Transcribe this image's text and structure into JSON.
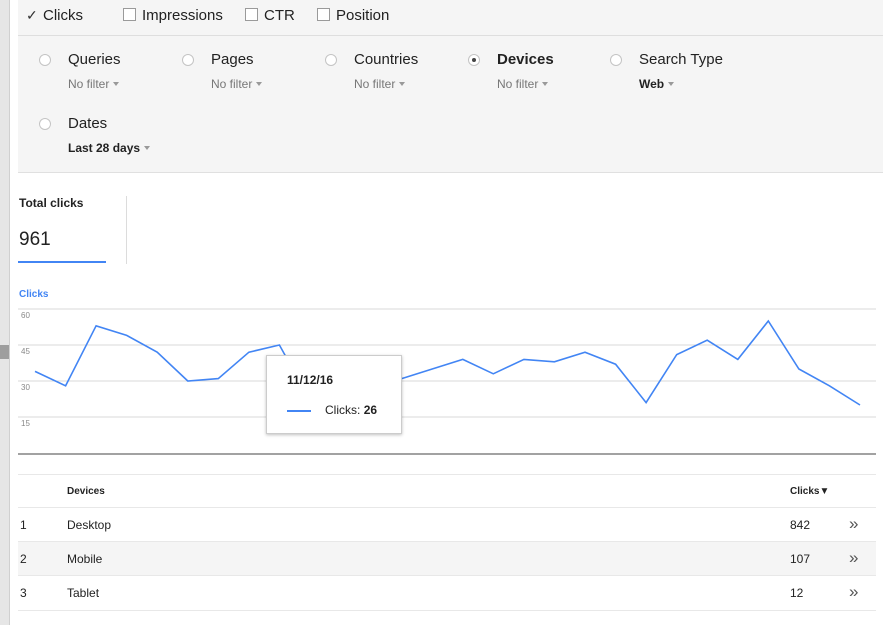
{
  "metrics": [
    {
      "label": "Clicks",
      "checked": true
    },
    {
      "label": "Impressions",
      "checked": false
    },
    {
      "label": "CTR",
      "checked": false
    },
    {
      "label": "Position",
      "checked": false
    }
  ],
  "check_glyph": "✓",
  "filters": [
    {
      "name": "Queries",
      "value": "No filter",
      "selected": false
    },
    {
      "name": "Pages",
      "value": "No filter",
      "selected": false
    },
    {
      "name": "Countries",
      "value": "No filter",
      "selected": false
    },
    {
      "name": "Devices",
      "value": "No filter",
      "selected": true
    },
    {
      "name": "Search Type",
      "value": "Web",
      "selected": false
    },
    {
      "name": "Dates",
      "value": "Last 28 days",
      "selected": false
    }
  ],
  "totals": {
    "label": "Total clicks",
    "value": "961"
  },
  "chart_data": {
    "type": "line",
    "title": "Clicks",
    "y_ticks": [
      60,
      45,
      30,
      15
    ],
    "ylim": [
      0,
      60
    ],
    "series": [
      {
        "name": "Clicks",
        "color": "#4285f4",
        "values": [
          34,
          28,
          53,
          49,
          42,
          30,
          31,
          42,
          45,
          22,
          18,
          27,
          31,
          35,
          39,
          33,
          39,
          38,
          42,
          37,
          21,
          41,
          47,
          39,
          55,
          35,
          28,
          20
        ]
      }
    ],
    "grid": true,
    "highlight_index": 11
  },
  "tooltip": {
    "date": "11/12/16",
    "series_label": "Clicks:",
    "value": "26"
  },
  "table": {
    "columns": [
      "Devices",
      "Clicks"
    ],
    "sort_indicator": "▼",
    "row_action_glyph": "»",
    "rows": [
      {
        "rank": "1",
        "device": "Desktop",
        "clicks": "842"
      },
      {
        "rank": "2",
        "device": "Mobile",
        "clicks": "107"
      },
      {
        "rank": "3",
        "device": "Tablet",
        "clicks": "12"
      }
    ]
  }
}
